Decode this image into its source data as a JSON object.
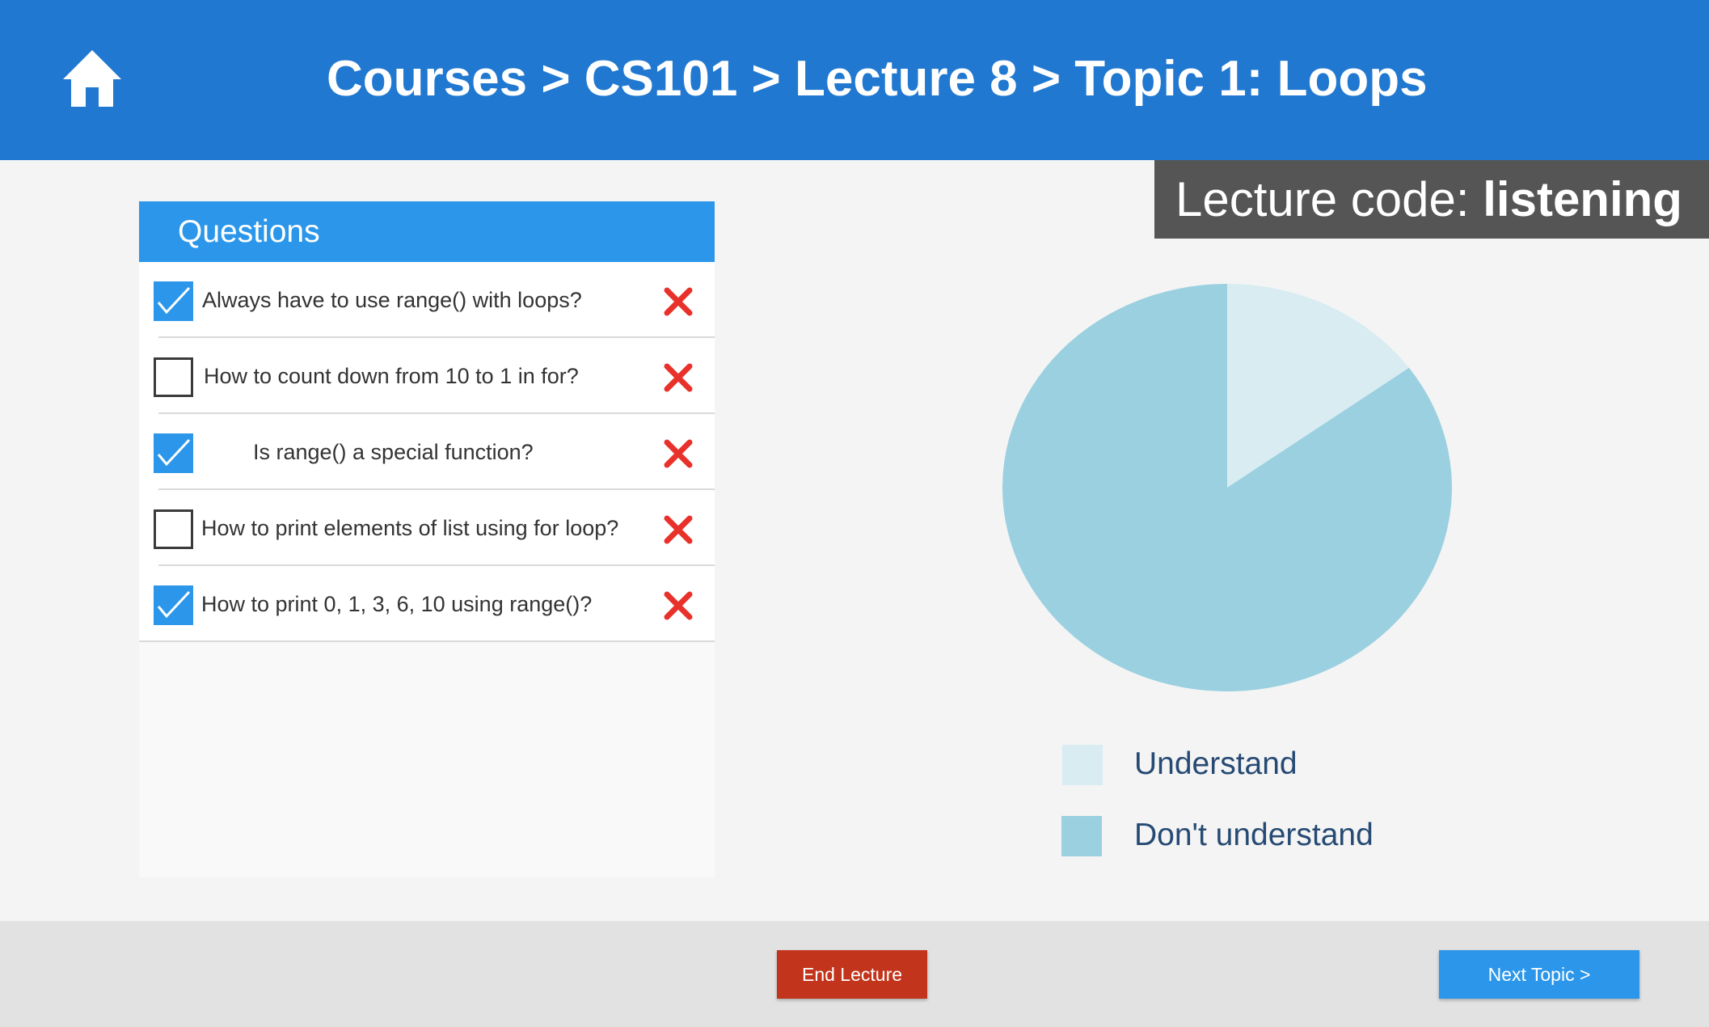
{
  "header": {
    "breadcrumb": "Courses > CS101 > Lecture 8 > Topic 1: Loops",
    "home_icon": "home-icon"
  },
  "lecture_code": {
    "label": "Lecture code: ",
    "value": "listening"
  },
  "questions": {
    "title": "Questions",
    "items": [
      {
        "text": "Always have to use range() with loops?",
        "checked": true
      },
      {
        "text": "How to count down from 10 to 1 in for?",
        "checked": false
      },
      {
        "text": "Is range() a special function?",
        "checked": true
      },
      {
        "text": "How to print elements of list using for loop?",
        "checked": false
      },
      {
        "text": "How to print 0, 1, 3, 6, 10 using range()?",
        "checked": true
      }
    ],
    "delete_icon": "close-icon",
    "check_color": "#2c97ea"
  },
  "chart_data": {
    "type": "pie",
    "labels": [
      "Understand",
      "Don't understand"
    ],
    "values": [
      15,
      85
    ],
    "colors": [
      "#d8ecf2",
      "#9bd0e0"
    ],
    "legend": "bottom"
  },
  "footer": {
    "end_label": "End Lecture",
    "next_label": "Next Topic >"
  },
  "colors": {
    "header": "#2178d0",
    "accent": "#2c97ea",
    "danger": "#c2341c",
    "delete": "#e8312a"
  }
}
